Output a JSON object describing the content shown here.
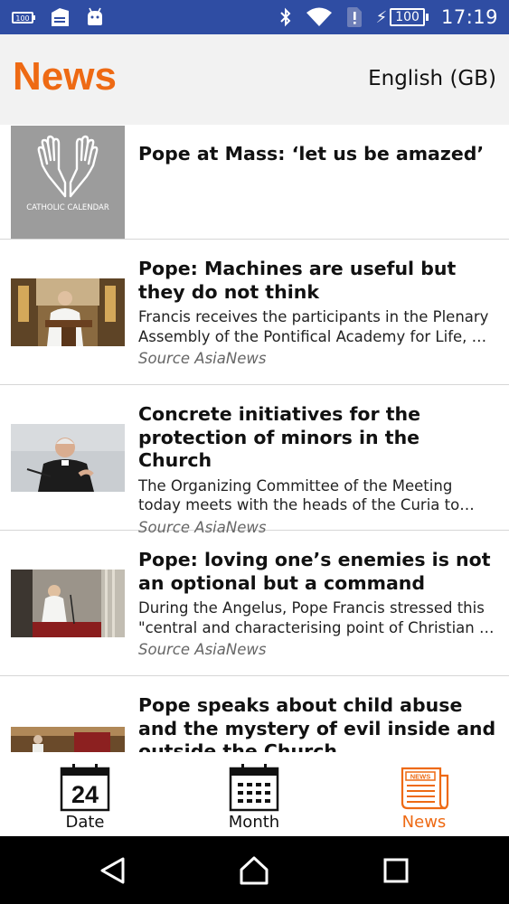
{
  "status_bar": {
    "time": "17:19",
    "battery": "100"
  },
  "header": {
    "title": "News",
    "language": "English (GB)"
  },
  "thumb_caption": "CATHOLIC CALENDAR",
  "news": [
    {
      "title": "Pope at Mass: ‘let us be amazed’",
      "description": "",
      "source": ""
    },
    {
      "title": "Pope: Machines are useful but they do not think",
      "description": "Francis receives the participants in the Plenary Assembly of the Pontifical Academy for Life, …",
      "source": "Source AsiaNews"
    },
    {
      "title": "Concrete initiatives for the protection of minors in the Church",
      "description": "The Organizing Committee of the Meeting today meets with the heads of the Curia to im…",
      "source": "Source AsiaNews"
    },
    {
      "title": "Pope: loving one’s enemies is not an optional but a command",
      "description": "During the Angelus, Pope Francis stressed this \"central and characterising point of Christian …",
      "source": "Source AsiaNews"
    },
    {
      "title": "Pope speaks about child abuse and the mystery of evil inside and outside the Church",
      "description": "",
      "source": ""
    }
  ],
  "bottom_nav": {
    "date_label": "Date",
    "date_number": "24",
    "month_label": "Month",
    "news_label": "News",
    "news_icon_text": "NEWS"
  },
  "colors": {
    "accent": "#ee6a14",
    "status_bar": "#2f4da3",
    "header_bg": "#f2f2f2"
  }
}
